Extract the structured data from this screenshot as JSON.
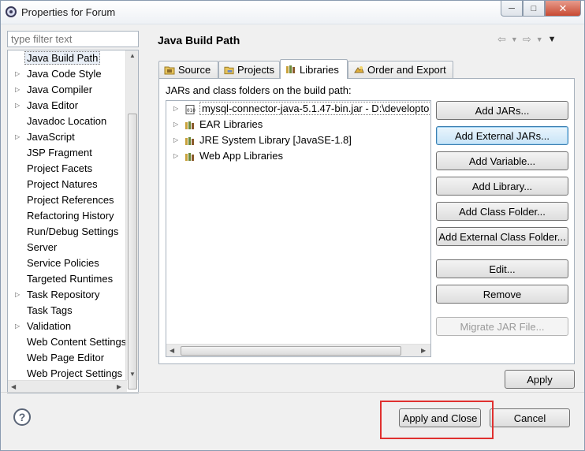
{
  "window": {
    "title": "Properties for Forum",
    "minimize": "─",
    "maximize": "□",
    "close": "✕"
  },
  "sidebar": {
    "filter_placeholder": "type filter text",
    "items": [
      {
        "label": "Java Build Path",
        "expandable": false,
        "selected": true
      },
      {
        "label": "Java Code Style",
        "expandable": true
      },
      {
        "label": "Java Compiler",
        "expandable": true
      },
      {
        "label": "Java Editor",
        "expandable": true
      },
      {
        "label": "Javadoc Location",
        "expandable": false
      },
      {
        "label": "JavaScript",
        "expandable": true
      },
      {
        "label": "JSP Fragment",
        "expandable": false
      },
      {
        "label": "Project Facets",
        "expandable": false
      },
      {
        "label": "Project Natures",
        "expandable": false
      },
      {
        "label": "Project References",
        "expandable": false
      },
      {
        "label": "Refactoring History",
        "expandable": false
      },
      {
        "label": "Run/Debug Settings",
        "expandable": false
      },
      {
        "label": "Server",
        "expandable": false
      },
      {
        "label": "Service Policies",
        "expandable": false
      },
      {
        "label": "Targeted Runtimes",
        "expandable": false
      },
      {
        "label": "Task Repository",
        "expandable": true
      },
      {
        "label": "Task Tags",
        "expandable": false
      },
      {
        "label": "Validation",
        "expandable": true
      },
      {
        "label": "Web Content Settings",
        "expandable": false
      },
      {
        "label": "Web Page Editor",
        "expandable": false
      },
      {
        "label": "Web Project Settings",
        "expandable": false
      }
    ]
  },
  "page": {
    "title": "Java Build Path",
    "tabs": [
      {
        "label": "Source",
        "icon": "source-folder-icon"
      },
      {
        "label": "Projects",
        "icon": "projects-folder-icon"
      },
      {
        "label": "Libraries",
        "icon": "libraries-icon",
        "active": true
      },
      {
        "label": "Order and Export",
        "icon": "order-export-icon"
      }
    ],
    "libraries_label": "JARs and class folders on the build path:",
    "tree_items": [
      {
        "label": "mysql-connector-java-5.1.47-bin.jar - D:\\developto",
        "icon": "jar-icon",
        "selected": true
      },
      {
        "label": "EAR Libraries",
        "icon": "library-icon"
      },
      {
        "label": "JRE System Library [JavaSE-1.8]",
        "icon": "library-icon"
      },
      {
        "label": "Web App Libraries",
        "icon": "library-icon"
      }
    ],
    "buttons": {
      "add_jars": "Add JARs...",
      "add_external_jars": "Add External JARs...",
      "add_variable": "Add Variable...",
      "add_library": "Add Library...",
      "add_class_folder": "Add Class Folder...",
      "add_external_class_folder": "Add External Class Folder...",
      "edit": "Edit...",
      "remove": "Remove",
      "migrate_jar": "Migrate JAR File..."
    },
    "apply": "Apply"
  },
  "footer": {
    "help": "?",
    "apply_and_close": "Apply and Close",
    "cancel": "Cancel"
  },
  "colors": {
    "highlight": "#e0302f",
    "focus": "#3c7fb1"
  }
}
